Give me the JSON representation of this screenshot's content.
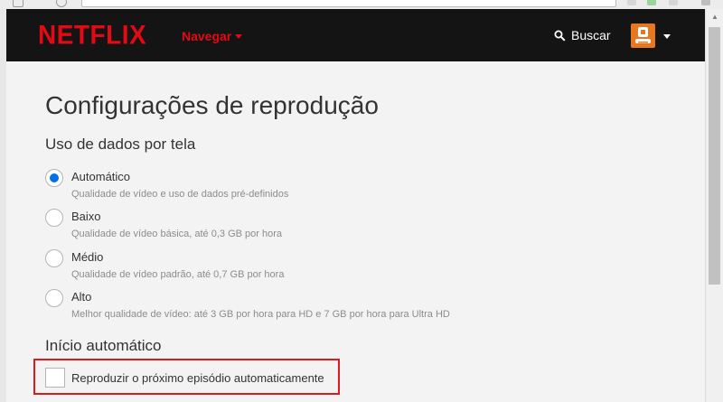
{
  "header": {
    "logo": "NETFLIX",
    "nav_browse": "Navegar",
    "search_label": "Buscar"
  },
  "main": {
    "title": "Configurações de reprodução",
    "data_usage": {
      "heading": "Uso de dados por tela",
      "selected": "Automático",
      "options": [
        {
          "label": "Automático",
          "description": "Qualidade de vídeo e uso de dados pré-definidos"
        },
        {
          "label": "Baixo",
          "description": "Qualidade de vídeo básica, até 0,3 GB por hora"
        },
        {
          "label": "Médio",
          "description": "Qualidade de vídeo padrão, até 0,7 GB por hora"
        },
        {
          "label": "Alto",
          "description": "Melhor qualidade de vídeo: até 3 GB por hora para HD e 7 GB por hora para Ultra HD"
        }
      ]
    },
    "autoplay": {
      "heading": "Início automático",
      "next_episode_label": "Reproduzir o próximo episódio automaticamente",
      "next_episode_checked": false
    }
  },
  "colors": {
    "brand_red": "#e50914",
    "header_bg": "#141414",
    "radio_selected": "#0071eb",
    "highlight_box": "#e0191f",
    "avatar_bg": "#e87722"
  },
  "icons": [
    "search-icon",
    "profile-avatar-icon",
    "chevron-down-icon"
  ]
}
